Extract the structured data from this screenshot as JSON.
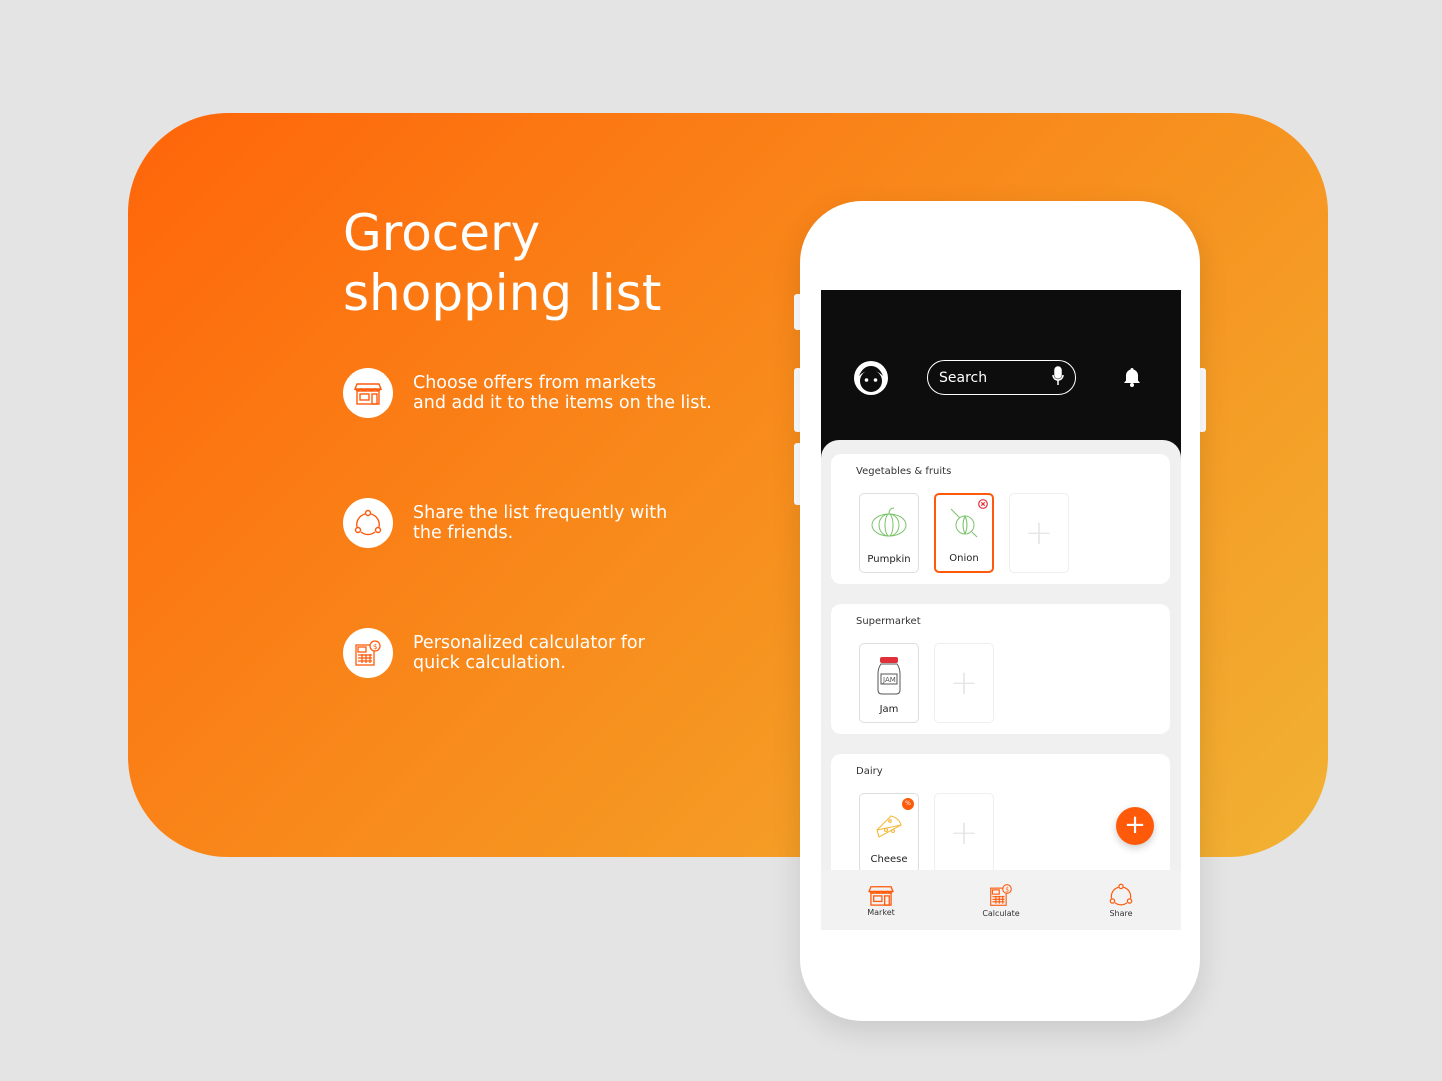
{
  "hero": {
    "title_line1": "Grocery",
    "title_line2": "shopping list"
  },
  "features": [
    {
      "icon": "store-icon",
      "line1": "Choose offers from markets",
      "line2": "and add it to the items on the list."
    },
    {
      "icon": "share-icon",
      "line1": "Share the list frequently with",
      "line2": "the friends."
    },
    {
      "icon": "calculator-icon",
      "line1": "Personalized calculator for",
      "line2": "quick calculation."
    }
  ],
  "app": {
    "search_placeholder": "Search",
    "sections": [
      {
        "title": "Vegetables & fruits",
        "items": [
          {
            "label": "Pumpkin"
          },
          {
            "label": "Onion",
            "selected": true
          }
        ]
      },
      {
        "title": "Supermarket",
        "items": [
          {
            "label": "Jam"
          }
        ]
      },
      {
        "title": "Dairy",
        "items": [
          {
            "label": "Cheese",
            "badge": "%"
          }
        ]
      }
    ],
    "add_symbol": "+",
    "nav": [
      {
        "label": "Market",
        "icon": "store-icon"
      },
      {
        "label": "Calculate",
        "icon": "calculator-icon"
      },
      {
        "label": "Share",
        "icon": "share-icon"
      }
    ]
  },
  "colors": {
    "accent": "#ff5a0a",
    "gradient_start": "#ff650a",
    "gradient_end": "#f1b233",
    "header": "#0d0d0d"
  }
}
